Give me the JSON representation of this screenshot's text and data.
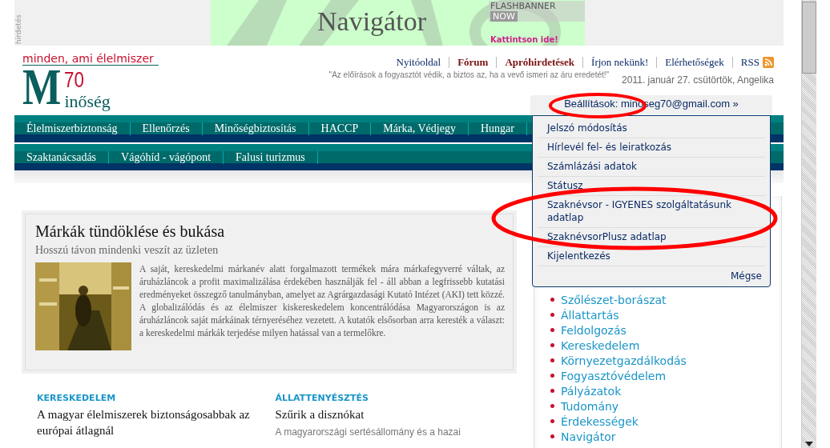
{
  "ad": {
    "side_label": "hirdetés",
    "title": "Navigátor",
    "badge_main": "FLASHBANNER",
    "badge_tag": "NOW",
    "cta": "Kattintson ide!"
  },
  "logo": {
    "tagline": "minden, ami élelmiszer",
    "letter": "M",
    "number": "70",
    "word": "inőség"
  },
  "top_links": [
    {
      "label": "Nyitóoldal",
      "kind": "plain"
    },
    {
      "label": "Fórum",
      "kind": "bold"
    },
    {
      "label": "Apróhirdetések",
      "kind": "bold"
    },
    {
      "label": "Írjon nekünk!",
      "kind": "plain"
    },
    {
      "label": "Elérhetőségek",
      "kind": "plain"
    },
    {
      "label": "RSS",
      "kind": "rss"
    }
  ],
  "quote": "\"Az előírások a fogyasztót védik, a biztos az, ha a vevő ismeri az áru eredetét!\"",
  "date_line": "2011. január 27. csütörtök, Angelika",
  "account": {
    "label": "Beállítások: minoseg70@gmail.com »",
    "menu": [
      "Jelszó módosítás",
      "Hírlevél fel- és leiratkozás",
      "Számlázási adatok",
      "Státusz",
      "Szaknévsor - IGYENES szolgáltatásunk adatlap",
      "SzaknévsorPlusz adatlap",
      "Kijelentkezés"
    ],
    "cancel": "Mégse"
  },
  "nav_primary": [
    "Élelmiszerbiztonság",
    "Ellenőrzés",
    "Minőségbiztosítás",
    "HACCP",
    "Márka, Védjegy",
    "Hungar"
  ],
  "nav_secondary": [
    "Szaktanácsadás",
    "Vágóhíd - vágópont",
    "Falusi turizmus"
  ],
  "feature": {
    "title": "Márkák tündöklése és bukása",
    "subtitle": "Hosszú távon mindenki veszít az üzleten",
    "body": "A saját, kereskedelmi márkanév alatt forgalmazott termékek mára márkafegyverré váltak, az áruházláncok a profit maximalizálása érdekében használják fel - áll abban a legfrissebb kutatási eredményeket összegző tanulmányban, amelyet az Agrárgazdasági Kutató Intézet (AKI) tett közzé. A globalizálódás és az élelmiszer kiskereskedelem koncentrálódása Magyarországon is az áruházláncok saját márkáinak térnyeréséhez vezetett. A kutatók elsősorban arra keresték a választ: a kereskedelmi márkák terjedése milyen hatással van a termelőkre."
  },
  "sections": [
    {
      "category": "KERESKEDELEM",
      "headline": "A magyar élelmiszerek biztonságosabbak az európai átlagnál"
    },
    {
      "category": "ÁLLATTENYÉSZTÉS",
      "headline": "Szűrik a disznókat",
      "teaser": "A magyarországi sertésállomány és a hazai"
    }
  ],
  "sidebar_links": [
    "Szőlészet-borászat",
    "Állattartás",
    "Feldolgozás",
    "Kereskedelem",
    "Környezetgazdálkodás",
    "Fogyasztóvédelem",
    "Pályázatok",
    "Tudomány",
    "Érdekességek",
    "Navigátor"
  ]
}
